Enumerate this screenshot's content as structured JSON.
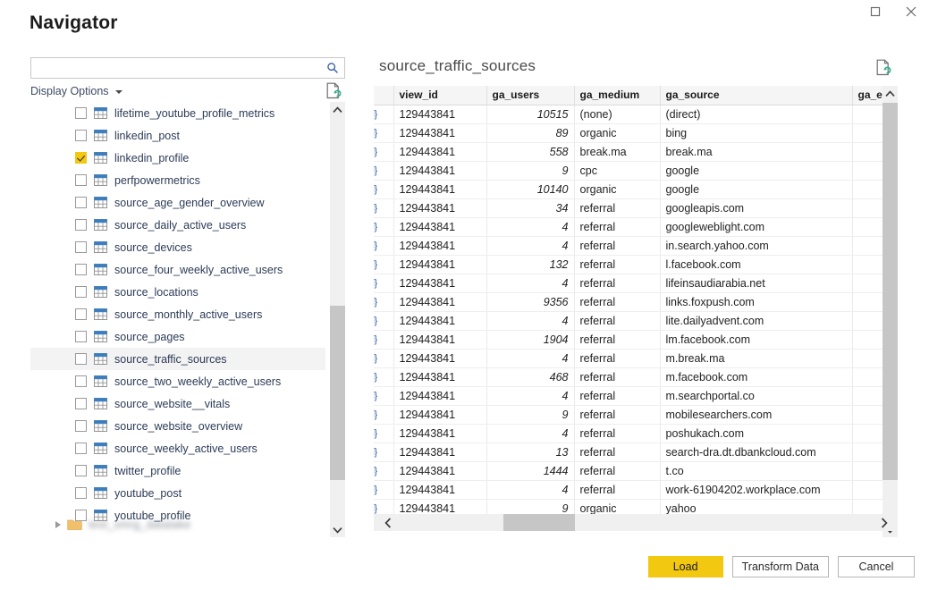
{
  "window": {
    "title": "Navigator",
    "controls": [
      {
        "name": "maximize-button",
        "icon": "maximize-icon"
      },
      {
        "name": "close-button",
        "icon": "close-icon"
      }
    ]
  },
  "left_pane": {
    "search": {
      "value": "",
      "placeholder": "",
      "icon": "search-icon"
    },
    "display_options": {
      "label": "Display Options",
      "icon": "chevron-down-icon"
    },
    "refresh_icon": "refresh-page-icon",
    "tree_items": [
      {
        "label": "lifetime_youtube_profile_metrics",
        "checked": false,
        "selected": false
      },
      {
        "label": "linkedin_post",
        "checked": false,
        "selected": false
      },
      {
        "label": "linkedin_profile",
        "checked": true,
        "selected": false
      },
      {
        "label": "perfpowermetrics",
        "checked": false,
        "selected": false
      },
      {
        "label": "source_age_gender_overview",
        "checked": false,
        "selected": false
      },
      {
        "label": "source_daily_active_users",
        "checked": false,
        "selected": false
      },
      {
        "label": "source_devices",
        "checked": false,
        "selected": false
      },
      {
        "label": "source_four_weekly_active_users",
        "checked": false,
        "selected": false
      },
      {
        "label": "source_locations",
        "checked": false,
        "selected": false
      },
      {
        "label": "source_monthly_active_users",
        "checked": false,
        "selected": false
      },
      {
        "label": "source_pages",
        "checked": false,
        "selected": false
      },
      {
        "label": "source_traffic_sources",
        "checked": false,
        "selected": true
      },
      {
        "label": "source_two_weekly_active_users",
        "checked": false,
        "selected": false
      },
      {
        "label": "source_website__vitals",
        "checked": false,
        "selected": false
      },
      {
        "label": "source_website_overview",
        "checked": false,
        "selected": false
      },
      {
        "label": "source_weekly_active_users",
        "checked": false,
        "selected": false
      },
      {
        "label": "twitter_profile",
        "checked": false,
        "selected": false
      },
      {
        "label": "youtube_post",
        "checked": false,
        "selected": false
      },
      {
        "label": "youtube_profile",
        "checked": false,
        "selected": false
      }
    ],
    "folder_node": {
      "label": "test_smrg_datalake",
      "redacted": true,
      "icon": "folder-icon",
      "expander": "expand-triangle-icon"
    },
    "scrollbar": {
      "up_icon": "chevron-up-icon",
      "down_icon": "chevron-down-icon"
    }
  },
  "right_pane": {
    "preview_title": "source_traffic_sources",
    "refresh_icon": "refresh-page-icon",
    "columns": [
      "",
      "view_id",
      "ga_users",
      "ga_medium",
      "ga_source",
      "ga_exi"
    ],
    "row_icon": "record-brace-icon",
    "rows": [
      {
        "view_id": "129443841",
        "ga_users": "10515",
        "ga_medium": "(none)",
        "ga_source": "(direct)"
      },
      {
        "view_id": "129443841",
        "ga_users": "89",
        "ga_medium": "organic",
        "ga_source": "bing"
      },
      {
        "view_id": "129443841",
        "ga_users": "558",
        "ga_medium": "break.ma",
        "ga_source": "break.ma"
      },
      {
        "view_id": "129443841",
        "ga_users": "9",
        "ga_medium": "cpc",
        "ga_source": "google"
      },
      {
        "view_id": "129443841",
        "ga_users": "10140",
        "ga_medium": "organic",
        "ga_source": "google"
      },
      {
        "view_id": "129443841",
        "ga_users": "34",
        "ga_medium": "referral",
        "ga_source": "googleapis.com"
      },
      {
        "view_id": "129443841",
        "ga_users": "4",
        "ga_medium": "referral",
        "ga_source": "googleweblight.com"
      },
      {
        "view_id": "129443841",
        "ga_users": "4",
        "ga_medium": "referral",
        "ga_source": "in.search.yahoo.com"
      },
      {
        "view_id": "129443841",
        "ga_users": "132",
        "ga_medium": "referral",
        "ga_source": "l.facebook.com"
      },
      {
        "view_id": "129443841",
        "ga_users": "4",
        "ga_medium": "referral",
        "ga_source": "lifeinsaudiarabia.net"
      },
      {
        "view_id": "129443841",
        "ga_users": "9356",
        "ga_medium": "referral",
        "ga_source": "links.foxpush.com"
      },
      {
        "view_id": "129443841",
        "ga_users": "4",
        "ga_medium": "referral",
        "ga_source": "lite.dailyadvent.com"
      },
      {
        "view_id": "129443841",
        "ga_users": "1904",
        "ga_medium": "referral",
        "ga_source": "lm.facebook.com"
      },
      {
        "view_id": "129443841",
        "ga_users": "4",
        "ga_medium": "referral",
        "ga_source": "m.break.ma"
      },
      {
        "view_id": "129443841",
        "ga_users": "468",
        "ga_medium": "referral",
        "ga_source": "m.facebook.com"
      },
      {
        "view_id": "129443841",
        "ga_users": "4",
        "ga_medium": "referral",
        "ga_source": "m.searchportal.co"
      },
      {
        "view_id": "129443841",
        "ga_users": "9",
        "ga_medium": "referral",
        "ga_source": "mobilesearchers.com"
      },
      {
        "view_id": "129443841",
        "ga_users": "4",
        "ga_medium": "referral",
        "ga_source": "poshukach.com"
      },
      {
        "view_id": "129443841",
        "ga_users": "13",
        "ga_medium": "referral",
        "ga_source": "search-dra.dt.dbankcloud.com"
      },
      {
        "view_id": "129443841",
        "ga_users": "1444",
        "ga_medium": "referral",
        "ga_source": "t.co"
      },
      {
        "view_id": "129443841",
        "ga_users": "4",
        "ga_medium": "referral",
        "ga_source": "work-61904202.workplace.com"
      },
      {
        "view_id": "129443841",
        "ga_users": "9",
        "ga_medium": "organic",
        "ga_source": "yahoo"
      }
    ],
    "vscrollbar": {
      "up_icon": "chevron-up-icon",
      "down_icon": "chevron-down-icon"
    },
    "hscrollbar": {
      "left_icon": "chevron-left-icon",
      "right_icon": "chevron-right-icon"
    }
  },
  "footer": {
    "load_label": "Load",
    "transform_label": "Transform Data",
    "cancel_label": "Cancel"
  },
  "colors": {
    "accent_yellow": "#f2c811",
    "table_icon_blue": "#3a7ebf",
    "folder_orange": "#f2c06b",
    "text_primary": "#1f1f1f",
    "tree_text": "#2c3b57"
  }
}
